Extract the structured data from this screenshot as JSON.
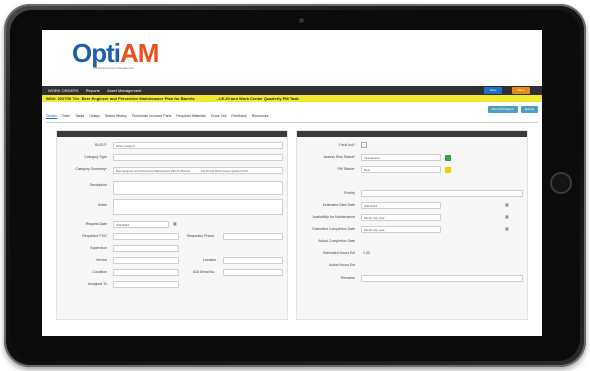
{
  "logo": {
    "text_o": "Opti",
    "text_am": "AM",
    "subtitle": "Optimized Asset Management"
  },
  "topnav": {
    "item1": "WORK ORDERS",
    "item2": "Reports",
    "item3": "Asset Management",
    "btn_blue": "Save",
    "btn_orange": "Back"
  },
  "titlebar": {
    "id": "WO#: 202709",
    "label": "Title:",
    "title_bold": "Beer Engineer and Preventive Maintenance Plan for Barrels",
    "suffix": "...LE.20 and Work Center Quarterly PM Task"
  },
  "actions": {
    "a1": "Print WO Report",
    "a2": "Submit"
  },
  "tabs": [
    "Details",
    "Team",
    "Tasks",
    "Delays",
    "Status History",
    "Technician Involved Parts",
    "Required Materials",
    "Close Out",
    "Feedback",
    "Resources"
  ],
  "left": {
    "bu_label": "BU/DT*",
    "bu_value": "Work category",
    "category_label": "Category Type",
    "summary_label": "Category Summary*",
    "summary_value": "Beer Engineer and Preventive Maintenance Plan for Barrels",
    "summary_value2": "...LE.20 and Work Center Quarterly PM",
    "desc_label": "Description",
    "notes_label": "Notes",
    "req_date_label": "Request Date",
    "req_date_value": "4/11/2022",
    "requestor_label": "Requestor POC",
    "phone_label": "Requestor Phone",
    "supervisor_label": "Supervisor",
    "vendor_label": "Vendor",
    "location_label": "Location",
    "condition_label": "Condition",
    "ida_label": "IDA Serial No.",
    "assigned_label": "Assigned To"
  },
  "right": {
    "fault_label": "Fault Ind?",
    "assess_label": "Assess Risk Status*",
    "assess_value": "Operational",
    "assess_color": "#3aa33a",
    "pm_label": "PM Status*",
    "pm_value": "New",
    "pm_color": "#e8d200",
    "priority_label": "Priority",
    "est_start_label": "Estimated Start Date",
    "est_start_value": "4/11/2022",
    "avail_label": "Availability for Maintenance",
    "avail_value": "Month day year",
    "est_comp_label": "Estimated Completion Date",
    "est_comp_value": "Month day year",
    "actual_comp_label": "Actual Completion Date",
    "est_hours_label": "Estimated Hours Est",
    "est_hours_value": "1.00",
    "actual_hours_label": "Actual Hours Est",
    "remarks_label": "Remarks"
  }
}
